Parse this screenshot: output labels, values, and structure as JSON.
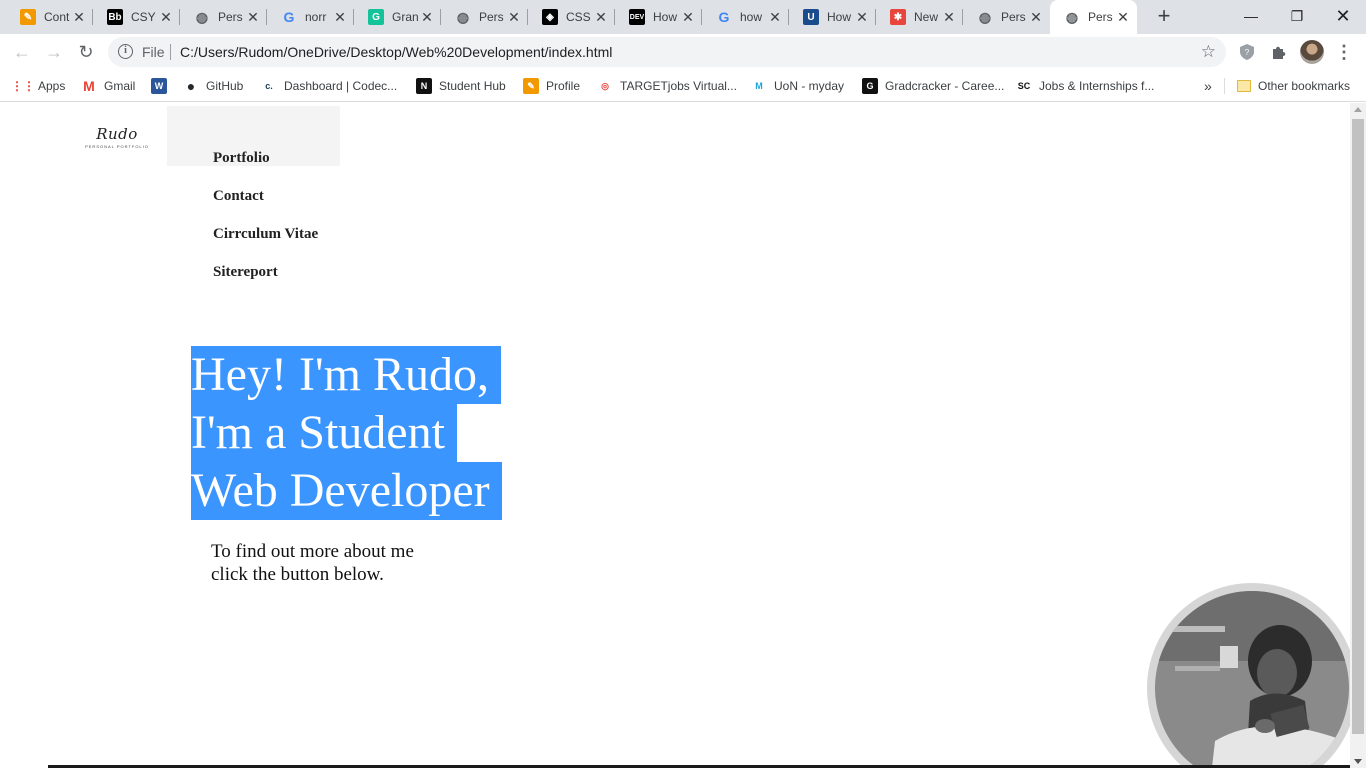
{
  "browser": {
    "tabs": [
      {
        "title": "Cont",
        "icon": "pencil-icon",
        "color": "#f29900"
      },
      {
        "title": "CSY",
        "icon": "blackboard-icon",
        "color": "#000000"
      },
      {
        "title": "Pers",
        "icon": "globe-icon",
        "color": "#5f6368"
      },
      {
        "title": "norr",
        "icon": "google-icon",
        "color": "#4285f4"
      },
      {
        "title": "Gran",
        "icon": "grammarly-icon",
        "color": "#15c39a"
      },
      {
        "title": "Pers",
        "icon": "globe-icon",
        "color": "#5f6368"
      },
      {
        "title": "CSS",
        "icon": "codepen-icon",
        "color": "#000000"
      },
      {
        "title": "How",
        "icon": "dev-icon",
        "color": "#000000"
      },
      {
        "title": "how",
        "icon": "google-icon",
        "color": "#4285f4"
      },
      {
        "title": "How",
        "icon": "shield-icon",
        "color": "#1a4b8c"
      },
      {
        "title": "New",
        "icon": "asterisk-icon",
        "color": "#e8453c"
      },
      {
        "title": "Pers",
        "icon": "globe-icon",
        "color": "#5f6368"
      },
      {
        "title": "Pers",
        "icon": "globe-icon",
        "color": "#5f6368",
        "active": true
      }
    ],
    "address": {
      "scheme_label": "File",
      "url": "C:/Users/Rudom/OneDrive/Desktop/Web%20Development/index.html"
    },
    "bookmarks": [
      {
        "label": "Apps",
        "icon": "apps-grid-icon"
      },
      {
        "label": "Gmail",
        "icon": "gmail-icon"
      },
      {
        "label": "",
        "icon": "word-icon"
      },
      {
        "label": "GitHub",
        "icon": "github-icon"
      },
      {
        "label": "Dashboard | Codec...",
        "icon": "codecademy-icon"
      },
      {
        "label": "Student Hub",
        "icon": "student-hub-icon"
      },
      {
        "label": "Profile",
        "icon": "pencil-icon"
      },
      {
        "label": "TARGETjobs Virtual...",
        "icon": "targetjobs-icon"
      },
      {
        "label": "UoN - myday",
        "icon": "myday-icon"
      },
      {
        "label": "Gradcracker - Caree...",
        "icon": "gradcracker-icon"
      },
      {
        "label": "Jobs & Internships f...",
        "icon": "sc-icon"
      }
    ],
    "more_bookmarks": "»",
    "other_bookmarks": "Other bookmarks"
  },
  "page": {
    "logo": {
      "script": "Rudo",
      "subtitle": "PERSONAL PORTFOLIO"
    },
    "nav": [
      "Portfolio",
      "Contact",
      "Cirrculum Vitae",
      "Sitereport"
    ],
    "hero": [
      "Hey! I'm Rudo,",
      "I'm a Student",
      "Web Developer"
    ],
    "intro": "To find out more about me click the button below.",
    "accent_color": "#3b95ff"
  }
}
